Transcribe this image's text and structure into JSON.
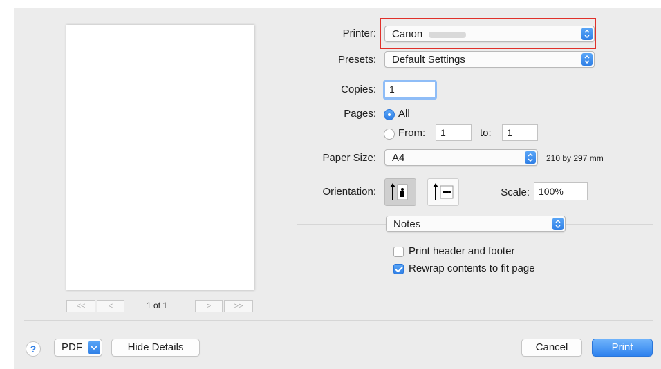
{
  "printer": {
    "label": "Printer:",
    "value": "Canon"
  },
  "presets": {
    "label": "Presets:",
    "value": "Default Settings"
  },
  "copies": {
    "label": "Copies:",
    "value": "1"
  },
  "pages": {
    "label": "Pages:",
    "all_label": "All",
    "from_label": "From:",
    "from_value": "1",
    "to_label": "to:",
    "to_value": "1",
    "selected": "All"
  },
  "paper_size": {
    "label": "Paper Size:",
    "value": "A4",
    "dimensions": "210 by 297 mm"
  },
  "orientation": {
    "label": "Orientation:",
    "selected": "portrait"
  },
  "scale": {
    "label": "Scale:",
    "value": "100%"
  },
  "section_popup": {
    "value": "Notes"
  },
  "options": [
    {
      "label": "Print header and footer",
      "checked": false
    },
    {
      "label": "Rewrap contents to fit page",
      "checked": true
    }
  ],
  "preview_nav": {
    "first": "<<",
    "prev": "<",
    "page_indicator": "1 of 1",
    "next": ">",
    "last": ">>"
  },
  "footer": {
    "help": "?",
    "pdf": "PDF",
    "hide_details": "Hide Details",
    "cancel": "Cancel",
    "print": "Print"
  },
  "colors": {
    "accent": "#2f7fe6",
    "highlight": "#e0302a",
    "background": "#ececec"
  }
}
